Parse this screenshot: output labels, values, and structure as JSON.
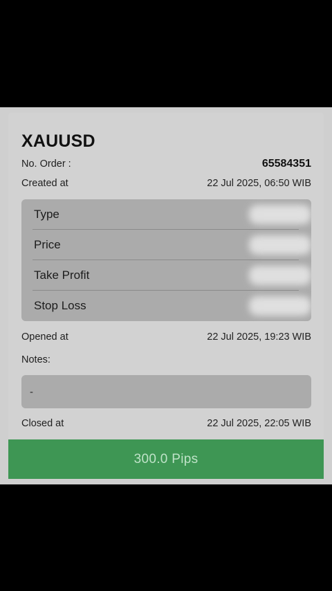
{
  "order": {
    "symbol": "XAUUSD",
    "number_label": "No. Order :",
    "number_value": "65584351",
    "created_label": "Created at",
    "created_value": "22 Jul 2025, 06:50 WIB"
  },
  "details": [
    {
      "label": "Type"
    },
    {
      "label": "Price"
    },
    {
      "label": "Take Profit"
    },
    {
      "label": "Stop Loss"
    }
  ],
  "opened": {
    "label": "Opened at",
    "value": "22 Jul 2025, 19:23 WIB"
  },
  "notes": {
    "label": "Notes:",
    "value": "-"
  },
  "closed": {
    "label": "Closed at",
    "value": "22 Jul 2025, 22:05 WIB"
  },
  "result": {
    "label": "300.0 Pips",
    "color": "#3e9654"
  }
}
